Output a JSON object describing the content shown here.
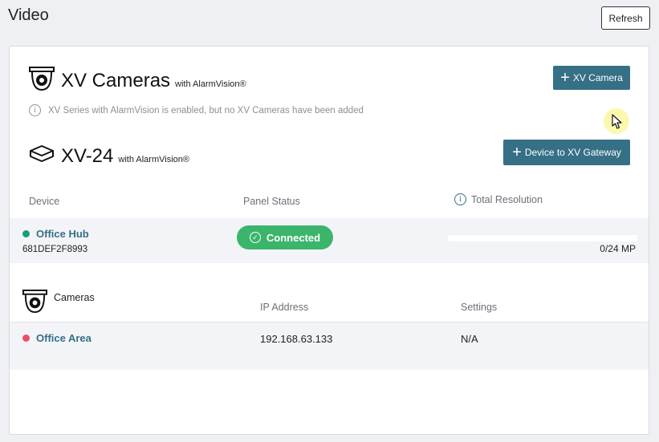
{
  "page": {
    "title": "Video",
    "refresh_label": "Refresh"
  },
  "xv_cameras": {
    "title": "XV Cameras",
    "subtitle": "with AlarmVision®",
    "add_button_label": "XV Camera",
    "info_text": "XV Series with AlarmVision is enabled, but no XV Cameras have been added"
  },
  "xv24": {
    "title": "XV-24",
    "subtitle": "with AlarmVision®",
    "add_button_label": "Device to XV Gateway",
    "columns": {
      "device": "Device",
      "panel_status": "Panel Status",
      "total_resolution": "Total Resolution"
    },
    "devices": [
      {
        "name": "Office Hub",
        "serial": "681DEF2F8993",
        "status_color": "#1a9b7e",
        "panel_status": "Connected",
        "resolution_used_fraction": 0,
        "resolution_text": "0/24 MP"
      }
    ]
  },
  "cameras": {
    "title": "Cameras",
    "columns": {
      "ip_address": "IP Address",
      "settings": "Settings"
    },
    "rows": [
      {
        "name": "Office Area",
        "status_color": "#e8506a",
        "ip_address": "192.168.63.133",
        "settings": "N/A"
      }
    ]
  },
  "colors": {
    "accent": "#357086",
    "connected": "#3bb56b"
  },
  "icons": [
    "dome-camera-icon",
    "gateway-box-icon",
    "info-icon",
    "plus-icon",
    "check-circle-icon",
    "mouse-cursor-icon"
  ]
}
